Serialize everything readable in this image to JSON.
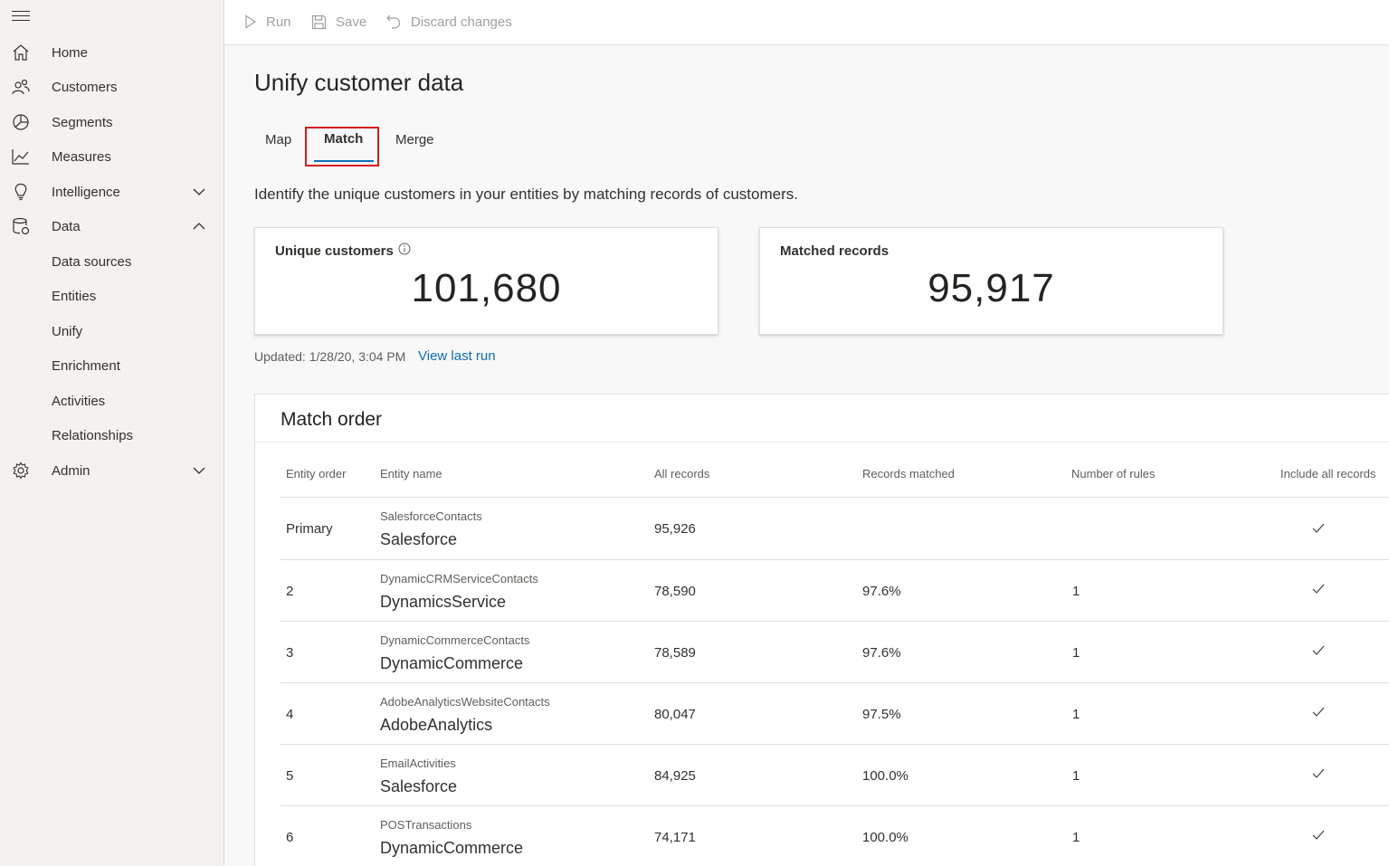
{
  "sidebar": {
    "menu_icon": "hamburger-icon",
    "items": [
      {
        "label": "Home",
        "icon": "home-icon"
      },
      {
        "label": "Customers",
        "icon": "people-icon"
      },
      {
        "label": "Segments",
        "icon": "pie-icon"
      },
      {
        "label": "Measures",
        "icon": "trend-icon"
      },
      {
        "label": "Intelligence",
        "icon": "lightbulb-icon"
      },
      {
        "label": "Data",
        "icon": "database-icon"
      },
      {
        "label": "Admin",
        "icon": "gear-icon"
      }
    ],
    "data_subitems": [
      "Data sources",
      "Entities",
      "Unify",
      "Enrichment",
      "Activities",
      "Relationships"
    ]
  },
  "toolbar": {
    "run_label": "Run",
    "save_label": "Save",
    "discard_label": "Discard changes"
  },
  "main": {
    "title": "Unify customer data",
    "tabs": [
      {
        "label": "Map"
      },
      {
        "label": "Match",
        "selected": true
      },
      {
        "label": "Merge"
      }
    ],
    "description": "Identify the unique customers in your entities by matching records of customers.",
    "cards": [
      {
        "title": "Unique customers",
        "value": "101,680"
      },
      {
        "title": "Matched records",
        "value": "95,917"
      }
    ],
    "updated": "Updated: 1/28/20, 3:04 PM",
    "view_last_run": "View last run"
  },
  "match_order": {
    "title": "Match order",
    "columns": [
      "Entity order",
      "Entity name",
      "All records",
      "Records matched",
      "Number of rules",
      "Include all records"
    ],
    "rows": [
      {
        "order": "Primary",
        "entity_sub": "SalesforceContacts",
        "entity": "Salesforce",
        "all_records": "95,926",
        "matched": "",
        "rules": "",
        "include_all": true
      },
      {
        "order": "2",
        "entity_sub": "DynamicCRMServiceContacts",
        "entity": "DynamicsService",
        "all_records": "78,590",
        "matched": "97.6%",
        "rules": "1",
        "include_all": true
      },
      {
        "order": "3",
        "entity_sub": "DynamicCommerceContacts",
        "entity": "DynamicCommerce",
        "all_records": "78,589",
        "matched": "97.6%",
        "rules": "1",
        "include_all": true
      },
      {
        "order": "4",
        "entity_sub": "AdobeAnalyticsWebsiteContacts",
        "entity": "AdobeAnalytics",
        "all_records": "80,047",
        "matched": "97.5%",
        "rules": "1",
        "include_all": true
      },
      {
        "order": "5",
        "entity_sub": "EmailActivities",
        "entity": "Salesforce",
        "all_records": "84,925",
        "matched": "100.0%",
        "rules": "1",
        "include_all": true
      },
      {
        "order": "6",
        "entity_sub": "POSTransactions",
        "entity": "DynamicCommerce",
        "all_records": "74,171",
        "matched": "100.0%",
        "rules": "1",
        "include_all": true
      }
    ]
  }
}
